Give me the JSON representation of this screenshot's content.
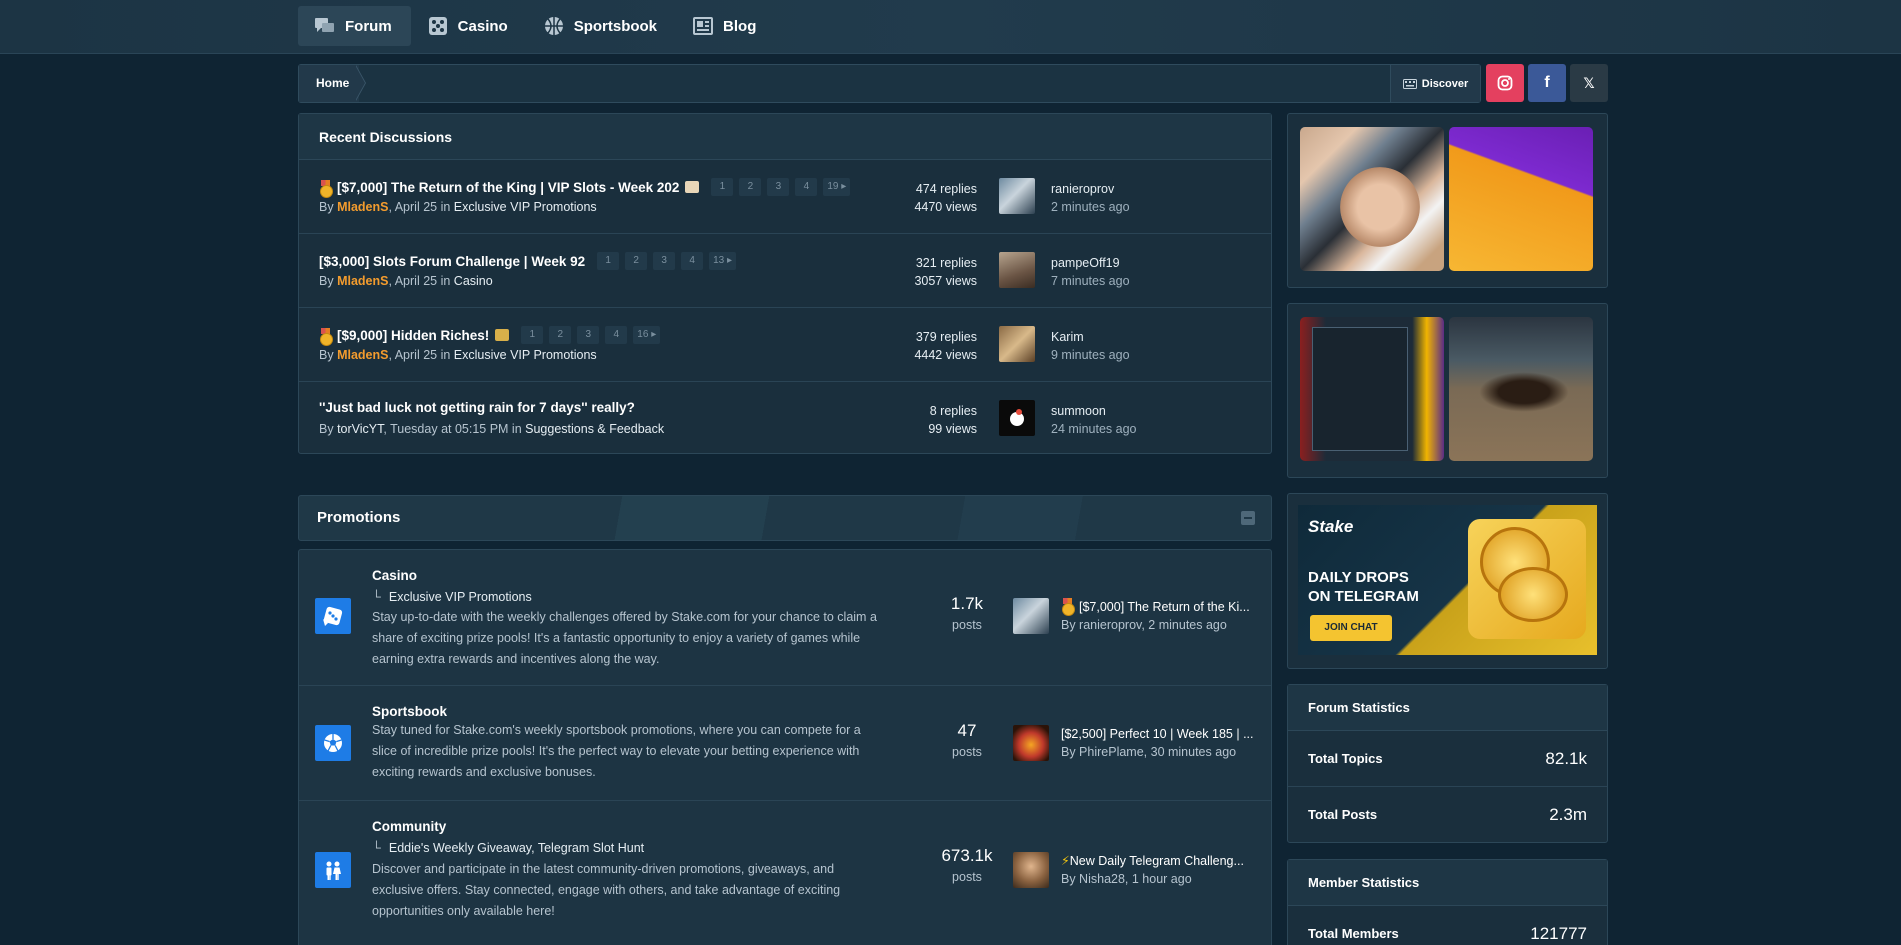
{
  "nav": [
    {
      "label": "Forum",
      "icon": "chat-bubbles-icon",
      "active": true
    },
    {
      "label": "Casino",
      "icon": "dice-icon",
      "active": false
    },
    {
      "label": "Sportsbook",
      "icon": "basketball-icon",
      "active": false
    },
    {
      "label": "Blog",
      "icon": "newspaper-icon",
      "active": false
    }
  ],
  "breadcrumb": {
    "home": "Home",
    "discover": "Discover"
  },
  "social": {
    "instagram": "instagram-icon",
    "facebook": "f",
    "x": "𝕏"
  },
  "recent": {
    "title": "Recent Discussions",
    "topics": [
      {
        "title": "[$7,000] The Return of the King | VIP Slots - Week 202",
        "medal": true,
        "emoji": true,
        "pages": [
          "1",
          "2",
          "3",
          "4",
          "19 ▸"
        ],
        "by": "By ",
        "author": "MladenS",
        "author_style": "staff",
        "date": ", April 25 in ",
        "forum": "Exclusive VIP Promotions",
        "replies": "474 replies",
        "views": "4470 views",
        "last_user": "ranieroprov",
        "last_time": "2 minutes ago"
      },
      {
        "title": "[$3,000] Slots Forum Challenge | Week 92",
        "medal": false,
        "emoji": false,
        "pages": [
          "1",
          "2",
          "3",
          "4",
          "13 ▸"
        ],
        "by": "By ",
        "author": "MladenS",
        "author_style": "staff",
        "date": ", April 25 in ",
        "forum": "Casino",
        "replies": "321 replies",
        "views": "3057 views",
        "last_user": "pampeOff19",
        "last_time": "7 minutes ago"
      },
      {
        "title": "[$9,000] Hidden Riches!",
        "medal": true,
        "emoji": true,
        "pages": [
          "1",
          "2",
          "3",
          "4",
          "16 ▸"
        ],
        "by": "By ",
        "author": "MladenS",
        "author_style": "staff",
        "date": ", April 25 in ",
        "forum": "Exclusive VIP Promotions",
        "replies": "379 replies",
        "views": "4442 views",
        "last_user": "Karim",
        "last_time": "9 minutes ago"
      },
      {
        "title": "''Just bad luck not getting rain for 7 days'' really?",
        "medal": false,
        "emoji": false,
        "pages": [],
        "by": "By ",
        "author": "torVicYT",
        "author_style": "plain",
        "date": ", Tuesday at 05:15 PM in ",
        "forum": "Suggestions & Feedback",
        "replies": "8 replies",
        "views": "99 views",
        "last_user": "summoon",
        "last_time": "24 minutes ago"
      }
    ]
  },
  "promotions": {
    "title": "Promotions",
    "categories": [
      {
        "name": "Casino",
        "subforums": "Exclusive VIP Promotions",
        "description": "Stay up-to-date with the weekly challenges offered by Stake.com for your chance to claim a share of exciting prize pools! It's a fantastic opportunity to enjoy a variety of games while earning extra rewards and incentives along the way.",
        "count": "1.7k",
        "count_label": "posts",
        "last_title": "[$7,000] The Return of the Ki...",
        "last_by": "By ranieroprov, 2 minutes ago",
        "icon": "dice-icon"
      },
      {
        "name": "Sportsbook",
        "subforums": "",
        "description": "Stay tuned for Stake.com's weekly sportsbook promotions, where you can compete for a slice of incredible prize pools! It's the perfect way to elevate your betting experience with exciting rewards and exclusive bonuses.",
        "count": "47",
        "count_label": "posts",
        "last_title": "[$2,500] Perfect 10 | Week 185 | ...",
        "last_by": "By PhirePlame, 30 minutes ago",
        "icon": "soccer-ball-icon"
      },
      {
        "name": "Community",
        "subforums": "Eddie's Weekly Giveaway,  Telegram Slot Hunt",
        "description": "Discover and participate in the latest community-driven promotions, giveaways, and exclusive offers. Stay connected, engage with others, and take advantage of exciting opportunities only available here!",
        "count": "673.1k",
        "count_label": "posts",
        "last_title": "New Daily Telegram Challeng...",
        "last_by": "By Nisha28, 1 hour ago",
        "icon": "people-icon"
      }
    ]
  },
  "banner": {
    "brand": "Stake",
    "headline1": "DAILY DROPS",
    "headline2": "ON TELEGRAM",
    "cta": "JOIN CHAT"
  },
  "forum_stats": {
    "title": "Forum Statistics",
    "rows": [
      {
        "k": "Total Topics",
        "v": "82.1k"
      },
      {
        "k": "Total Posts",
        "v": "2.3m"
      }
    ]
  },
  "member_stats": {
    "title": "Member Statistics",
    "rows": [
      {
        "k": "Total Members",
        "v": "121777"
      }
    ]
  }
}
